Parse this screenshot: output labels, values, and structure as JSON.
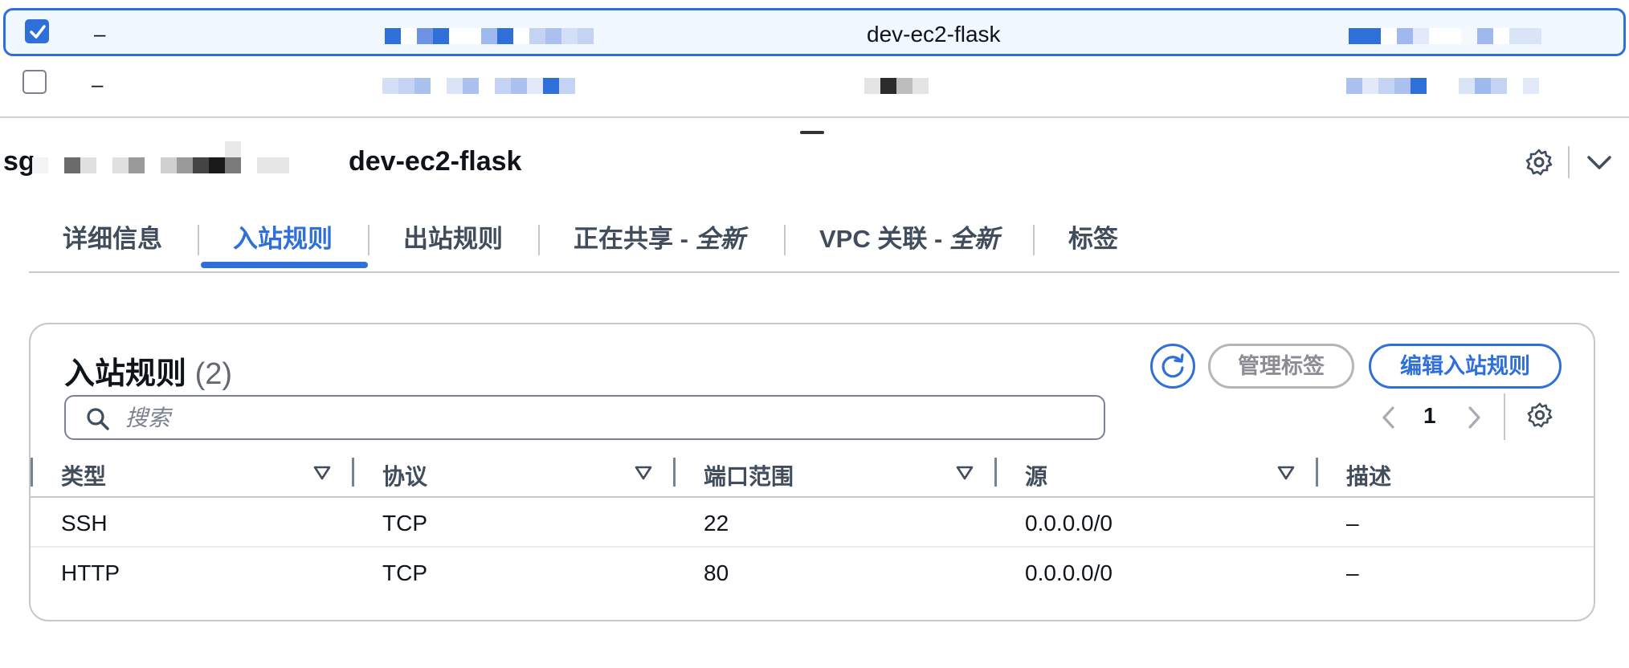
{
  "instances": [
    {
      "selected": true,
      "dash": "–",
      "name": "dev-ec2-flask"
    },
    {
      "selected": false,
      "dash": "–",
      "name": ""
    }
  ],
  "detail": {
    "sg_id_prefix": "sg-",
    "sg_name": "dev-ec2-flask"
  },
  "tabs": [
    {
      "label": "详细信息"
    },
    {
      "label": "入站规则",
      "active": true
    },
    {
      "label": "出站规则"
    },
    {
      "label": "正在共享 - ",
      "badge": "全新"
    },
    {
      "label": "VPC 关联 - ",
      "badge": "全新"
    },
    {
      "label": "标签"
    }
  ],
  "rules_panel": {
    "title": "入站规则",
    "count": "(2)",
    "manage_tags_label": "管理标签",
    "edit_rules_label": "编辑入站规则",
    "search_placeholder": "搜索",
    "current_page": "1",
    "columns": [
      "类型",
      "协议",
      "端口范围",
      "源",
      "描述"
    ],
    "rows": [
      {
        "type": "SSH",
        "protocol": "TCP",
        "port_range": "22",
        "source": "0.0.0.0/0",
        "description": "–"
      },
      {
        "type": "HTTP",
        "protocol": "TCP",
        "port_range": "80",
        "source": "0.0.0.0/0",
        "description": "–"
      }
    ]
  },
  "colors": {
    "accent": "#2f6fd9",
    "selected_row_bg": "#f1f8ff",
    "border": "#c6c6cd"
  }
}
